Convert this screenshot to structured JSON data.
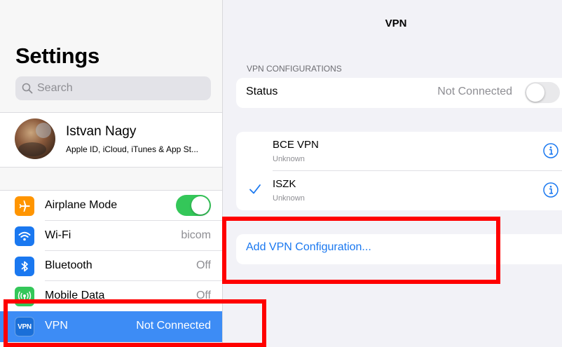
{
  "sidebar": {
    "title": "Settings",
    "search_placeholder": "Search",
    "profile": {
      "name": "Istvan Nagy",
      "subtitle": "Apple ID, iCloud, iTunes & App St..."
    },
    "items": [
      {
        "label": "Airplane Mode",
        "value": "",
        "icon": "airplane-icon",
        "color": "#ff9500",
        "toggle": "on"
      },
      {
        "label": "Wi-Fi",
        "value": "bicom",
        "icon": "wifi-icon",
        "color": "#1a78f0"
      },
      {
        "label": "Bluetooth",
        "value": "Off",
        "icon": "bluetooth-icon",
        "color": "#1a78f0"
      },
      {
        "label": "Mobile Data",
        "value": "Off",
        "icon": "antenna-icon",
        "color": "#34c759"
      },
      {
        "label": "VPN",
        "value": "Not Connected",
        "icon": "vpn-icon",
        "icon_text": "VPN",
        "color": "#1a6fd8",
        "selected": true
      }
    ]
  },
  "detail": {
    "title": "VPN",
    "section_header": "VPN CONFIGURATIONS",
    "status": {
      "label": "Status",
      "value": "Not Connected",
      "toggle": "off"
    },
    "configs": [
      {
        "name": "BCE VPN",
        "state": "Unknown",
        "checked": false
      },
      {
        "name": "ISZK",
        "state": "Unknown",
        "checked": true
      }
    ],
    "add_label": "Add VPN Configuration..."
  },
  "colors": {
    "accent": "#1a78f0",
    "selection": "#3d8cf5",
    "toggle_on": "#34c759",
    "annotation": "#ff0000"
  }
}
